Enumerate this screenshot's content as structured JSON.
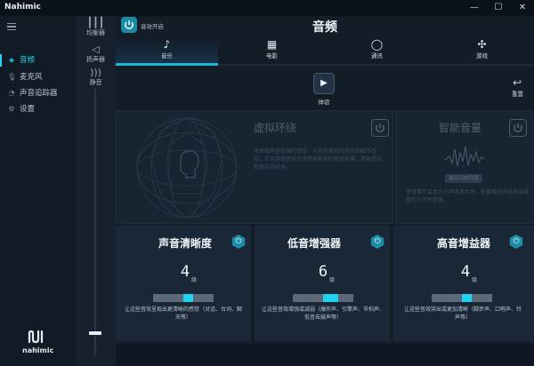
{
  "window": {
    "title": "Nahimic",
    "min_icon": "minimize-icon",
    "max_icon": "maximize-icon",
    "close_icon": "close-icon"
  },
  "sidebar": {
    "items": [
      {
        "label": "音频",
        "icon": "speaker-icon",
        "active": true
      },
      {
        "label": "麦克风",
        "icon": "microphone-icon",
        "active": false
      },
      {
        "label": "声音追踪器",
        "icon": "radar-icon",
        "active": false
      },
      {
        "label": "设置",
        "icon": "gear-icon",
        "active": false
      }
    ],
    "logo": "nahimic"
  },
  "equalizer_column": {
    "buttons": [
      {
        "label": "均衡器",
        "icon": "equalizer-icon"
      },
      {
        "label": "扬声器",
        "icon": "speaker-icon"
      },
      {
        "label": "静音",
        "icon": "mute-icon"
      }
    ],
    "volume_level": 0.07
  },
  "header": {
    "effect_toggle_label": "音效开启",
    "title": "音频"
  },
  "tabs": [
    {
      "label": "音乐",
      "icon": "music-note-icon",
      "active": true
    },
    {
      "label": "电影",
      "icon": "clapperboard-icon",
      "active": false
    },
    {
      "label": "通讯",
      "icon": "chat-bubble-icon",
      "active": false
    },
    {
      "label": "游戏",
      "icon": "gamepad-icon",
      "active": false
    }
  ],
  "actions": {
    "play_label": "体验",
    "reset_label": "重置"
  },
  "virtual_surround": {
    "title": "虚拟环绕",
    "desc": [
      "体验极声音包围的感受。从而有更好的音场和细节感知。实现游戏音效沉浸感和影视的极佳效果，还能感知到真实的环境。"
    ]
  },
  "smart_volume": {
    "title": "智能音量",
    "button_label": "最佳动态范围",
    "desc": [
      "使音量不会太大小声或太大声，依据播放内容自动调整的入不同音量。"
    ]
  },
  "cards": [
    {
      "title": "声音清晰度",
      "value": "4",
      "unit": "级",
      "level": 0.58,
      "desc": "让这些音效呈现出更清晰的感觉（对话、台词、聊天等）"
    },
    {
      "title": "低音增强器",
      "value": "6",
      "unit": "级",
      "level": 0.66,
      "desc": "让这些音效增强或减弱（爆炸声、引擎声、节拍声、低音击鼓声等）"
    },
    {
      "title": "高音增益器",
      "value": "4",
      "unit": "级",
      "level": 0.58,
      "desc": "让这些音效突出或更加清晰（脚步声、口哨声、铃声等）"
    }
  ]
}
